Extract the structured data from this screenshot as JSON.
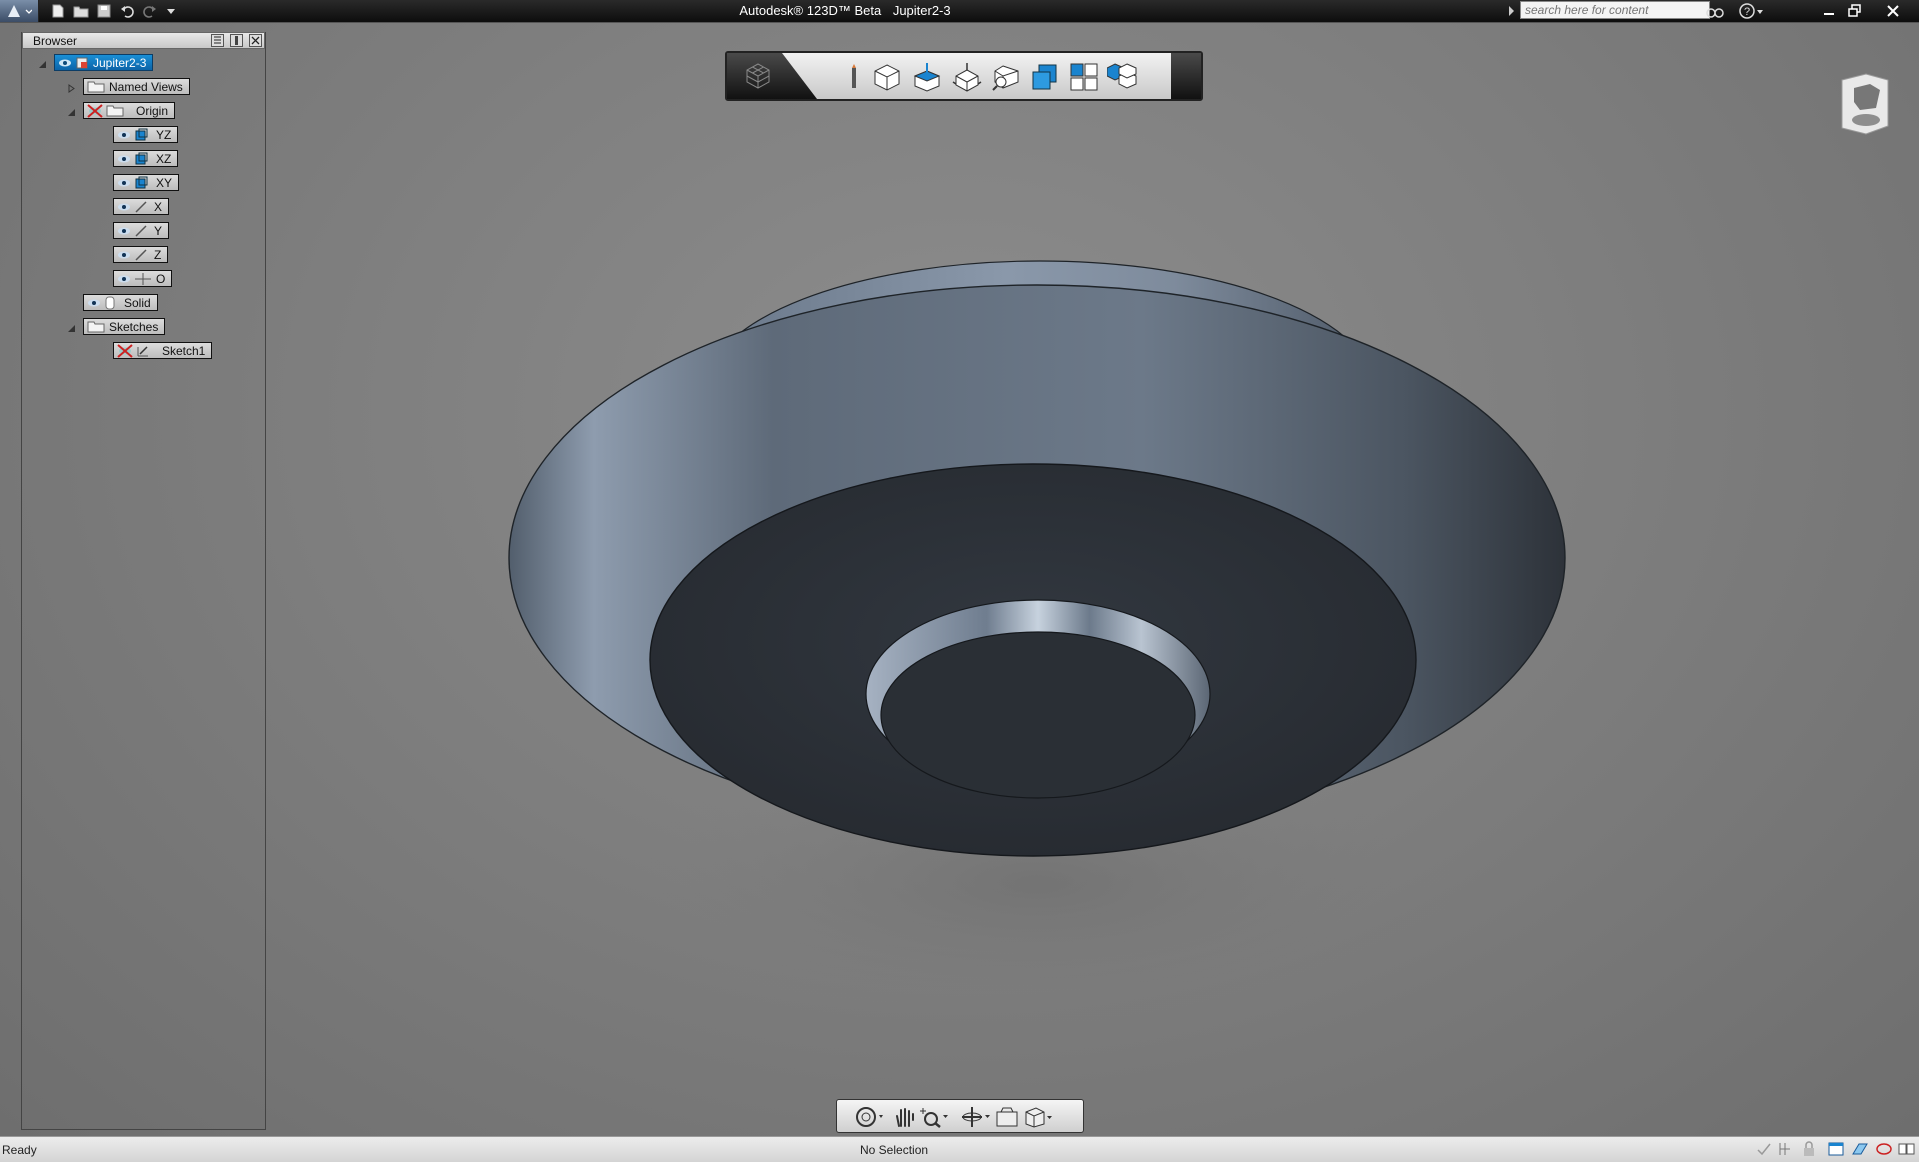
{
  "titlebar": {
    "app": "Autodesk® 123D™ Beta",
    "document": "Jupiter2-3",
    "search_placeholder": "search here for content"
  },
  "browser": {
    "title": "Browser",
    "nodes": [
      {
        "label": "Jupiter2-3",
        "selected": true
      },
      {
        "label": "Named Views"
      },
      {
        "label": "Origin"
      },
      {
        "label": "YZ"
      },
      {
        "label": "XZ"
      },
      {
        "label": "XY"
      },
      {
        "label": "X"
      },
      {
        "label": "Y"
      },
      {
        "label": "Z"
      },
      {
        "label": "O"
      },
      {
        "label": "Solid"
      },
      {
        "label": "Sketches"
      },
      {
        "label": "Sketch1"
      }
    ]
  },
  "view_toolbar": {
    "icons": [
      "home-view-icon",
      "look-at-icon",
      "front-view-icon",
      "top-view-icon",
      "isometric-view-icon",
      "perspective-view-icon",
      "shaded-icon",
      "quad-view-icon",
      "display-style-icon"
    ]
  },
  "navbar": {
    "icons": [
      "steering-wheel-icon",
      "pan-icon",
      "zoom-icon",
      "orbit-icon",
      "camera-icon",
      "view-cube-menu-icon"
    ]
  },
  "status": {
    "left": "Ready",
    "center": "No Selection"
  },
  "colors": {
    "selection": "#0c6fb8",
    "viewport": "#7e7e7e",
    "model": "#5b6878"
  }
}
